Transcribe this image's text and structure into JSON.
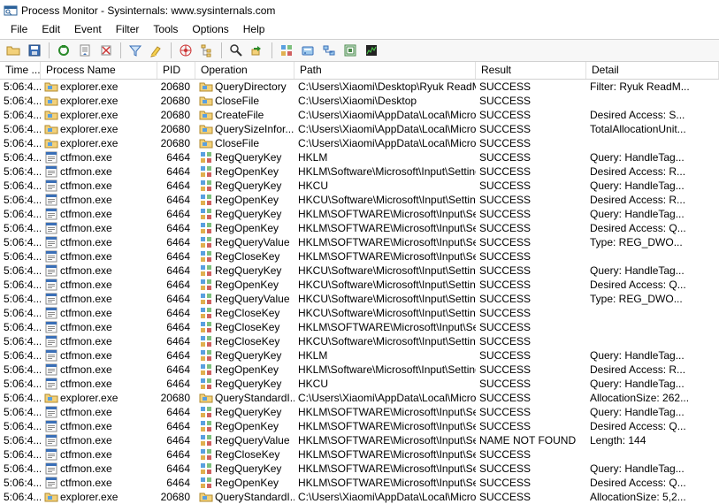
{
  "window": {
    "title": "Process Monitor - Sysinternals: www.sysinternals.com"
  },
  "menu": [
    "File",
    "Edit",
    "Event",
    "Filter",
    "Tools",
    "Options",
    "Help"
  ],
  "toolbar_icons": [
    "open-icon",
    "save-icon",
    "sep",
    "capture-icon",
    "autoscroll-icon",
    "clear-icon",
    "sep",
    "filter-icon",
    "highlight-icon",
    "sep",
    "include-process-icon",
    "tree-icon",
    "sep",
    "find-icon",
    "jump-icon",
    "sep",
    "registry-icon",
    "filesystem-icon",
    "network-icon",
    "process-icon",
    "profiling-icon"
  ],
  "columns": [
    "Time ...",
    "Process Name",
    "PID",
    "Operation",
    "Path",
    "Result",
    "Detail"
  ],
  "rows": [
    {
      "t": "5:06:4...",
      "proc": "explorer.exe",
      "pid": "20680",
      "ptype": "folder",
      "op": "QueryDirectory",
      "otype": "folder",
      "path": "C:\\Users\\Xiaomi\\Desktop\\Ryuk ReadM...",
      "res": "SUCCESS",
      "det": "Filter: Ryuk ReadM..."
    },
    {
      "t": "5:06:4...",
      "proc": "explorer.exe",
      "pid": "20680",
      "ptype": "folder",
      "op": "CloseFile",
      "otype": "folder",
      "path": "C:\\Users\\Xiaomi\\Desktop",
      "res": "SUCCESS",
      "det": ""
    },
    {
      "t": "5:06:4...",
      "proc": "explorer.exe",
      "pid": "20680",
      "ptype": "folder",
      "op": "CreateFile",
      "otype": "folder",
      "path": "C:\\Users\\Xiaomi\\AppData\\Local\\Micro...",
      "res": "SUCCESS",
      "det": "Desired Access: S..."
    },
    {
      "t": "5:06:4...",
      "proc": "explorer.exe",
      "pid": "20680",
      "ptype": "folder",
      "op": "QuerySizeInfor...",
      "otype": "folder",
      "path": "C:\\Users\\Xiaomi\\AppData\\Local\\Micro...",
      "res": "SUCCESS",
      "det": "TotalAllocationUnit..."
    },
    {
      "t": "5:06:4...",
      "proc": "explorer.exe",
      "pid": "20680",
      "ptype": "folder",
      "op": "CloseFile",
      "otype": "folder",
      "path": "C:\\Users\\Xiaomi\\AppData\\Local\\Micro...",
      "res": "SUCCESS",
      "det": ""
    },
    {
      "t": "5:06:4...",
      "proc": "ctfmon.exe",
      "pid": "6464",
      "ptype": "app",
      "op": "RegQueryKey",
      "otype": "reg",
      "path": "HKLM",
      "res": "SUCCESS",
      "det": "Query: HandleTag..."
    },
    {
      "t": "5:06:4...",
      "proc": "ctfmon.exe",
      "pid": "6464",
      "ptype": "app",
      "op": "RegOpenKey",
      "otype": "reg",
      "path": "HKLM\\Software\\Microsoft\\Input\\Settings",
      "res": "SUCCESS",
      "det": "Desired Access: R..."
    },
    {
      "t": "5:06:4...",
      "proc": "ctfmon.exe",
      "pid": "6464",
      "ptype": "app",
      "op": "RegQueryKey",
      "otype": "reg",
      "path": "HKCU",
      "res": "SUCCESS",
      "det": "Query: HandleTag..."
    },
    {
      "t": "5:06:4...",
      "proc": "ctfmon.exe",
      "pid": "6464",
      "ptype": "app",
      "op": "RegOpenKey",
      "otype": "reg",
      "path": "HKCU\\Software\\Microsoft\\Input\\Settin...",
      "res": "SUCCESS",
      "det": "Desired Access: R..."
    },
    {
      "t": "5:06:4...",
      "proc": "ctfmon.exe",
      "pid": "6464",
      "ptype": "app",
      "op": "RegQueryKey",
      "otype": "reg",
      "path": "HKLM\\SOFTWARE\\Microsoft\\Input\\Se...",
      "res": "SUCCESS",
      "det": "Query: HandleTag..."
    },
    {
      "t": "5:06:4...",
      "proc": "ctfmon.exe",
      "pid": "6464",
      "ptype": "app",
      "op": "RegOpenKey",
      "otype": "reg",
      "path": "HKLM\\SOFTWARE\\Microsoft\\Input\\Se...",
      "res": "SUCCESS",
      "det": "Desired Access: Q..."
    },
    {
      "t": "5:06:4...",
      "proc": "ctfmon.exe",
      "pid": "6464",
      "ptype": "app",
      "op": "RegQueryValue",
      "otype": "reg",
      "path": "HKLM\\SOFTWARE\\Microsoft\\Input\\Se...",
      "res": "SUCCESS",
      "det": "Type: REG_DWO..."
    },
    {
      "t": "5:06:4...",
      "proc": "ctfmon.exe",
      "pid": "6464",
      "ptype": "app",
      "op": "RegCloseKey",
      "otype": "reg",
      "path": "HKLM\\SOFTWARE\\Microsoft\\Input\\Se...",
      "res": "SUCCESS",
      "det": ""
    },
    {
      "t": "5:06:4...",
      "proc": "ctfmon.exe",
      "pid": "6464",
      "ptype": "app",
      "op": "RegQueryKey",
      "otype": "reg",
      "path": "HKCU\\Software\\Microsoft\\Input\\Settin...",
      "res": "SUCCESS",
      "det": "Query: HandleTag..."
    },
    {
      "t": "5:06:4...",
      "proc": "ctfmon.exe",
      "pid": "6464",
      "ptype": "app",
      "op": "RegOpenKey",
      "otype": "reg",
      "path": "HKCU\\Software\\Microsoft\\Input\\Settin...",
      "res": "SUCCESS",
      "det": "Desired Access: Q..."
    },
    {
      "t": "5:06:4...",
      "proc": "ctfmon.exe",
      "pid": "6464",
      "ptype": "app",
      "op": "RegQueryValue",
      "otype": "reg",
      "path": "HKCU\\Software\\Microsoft\\Input\\Settin...",
      "res": "SUCCESS",
      "det": "Type: REG_DWO..."
    },
    {
      "t": "5:06:4...",
      "proc": "ctfmon.exe",
      "pid": "6464",
      "ptype": "app",
      "op": "RegCloseKey",
      "otype": "reg",
      "path": "HKCU\\Software\\Microsoft\\Input\\Settin...",
      "res": "SUCCESS",
      "det": ""
    },
    {
      "t": "5:06:4...",
      "proc": "ctfmon.exe",
      "pid": "6464",
      "ptype": "app",
      "op": "RegCloseKey",
      "otype": "reg",
      "path": "HKLM\\SOFTWARE\\Microsoft\\Input\\Se...",
      "res": "SUCCESS",
      "det": ""
    },
    {
      "t": "5:06:4...",
      "proc": "ctfmon.exe",
      "pid": "6464",
      "ptype": "app",
      "op": "RegCloseKey",
      "otype": "reg",
      "path": "HKCU\\Software\\Microsoft\\Input\\Settings",
      "res": "SUCCESS",
      "det": ""
    },
    {
      "t": "5:06:4...",
      "proc": "ctfmon.exe",
      "pid": "6464",
      "ptype": "app",
      "op": "RegQueryKey",
      "otype": "reg",
      "path": "HKLM",
      "res": "SUCCESS",
      "det": "Query: HandleTag..."
    },
    {
      "t": "5:06:4...",
      "proc": "ctfmon.exe",
      "pid": "6464",
      "ptype": "app",
      "op": "RegOpenKey",
      "otype": "reg",
      "path": "HKLM\\Software\\Microsoft\\Input\\Settings",
      "res": "SUCCESS",
      "det": "Desired Access: R..."
    },
    {
      "t": "5:06:4...",
      "proc": "ctfmon.exe",
      "pid": "6464",
      "ptype": "app",
      "op": "RegQueryKey",
      "otype": "reg",
      "path": "HKCU",
      "res": "SUCCESS",
      "det": "Query: HandleTag..."
    },
    {
      "t": "5:06:4...",
      "proc": "explorer.exe",
      "pid": "20680",
      "ptype": "folder",
      "op": "QueryStandardI...",
      "otype": "folder",
      "path": "C:\\Users\\Xiaomi\\AppData\\Local\\Micro...",
      "res": "SUCCESS",
      "det": "AllocationSize: 262..."
    },
    {
      "t": "5:06:4...",
      "proc": "ctfmon.exe",
      "pid": "6464",
      "ptype": "app",
      "op": "RegQueryKey",
      "otype": "reg",
      "path": "HKLM\\SOFTWARE\\Microsoft\\Input\\Se...",
      "res": "SUCCESS",
      "det": "Query: HandleTag..."
    },
    {
      "t": "5:06:4...",
      "proc": "ctfmon.exe",
      "pid": "6464",
      "ptype": "app",
      "op": "RegOpenKey",
      "otype": "reg",
      "path": "HKLM\\SOFTWARE\\Microsoft\\Input\\Se...",
      "res": "SUCCESS",
      "det": "Desired Access: Q..."
    },
    {
      "t": "5:06:4...",
      "proc": "ctfmon.exe",
      "pid": "6464",
      "ptype": "app",
      "op": "RegQueryValue",
      "otype": "reg",
      "path": "HKLM\\SOFTWARE\\Microsoft\\Input\\Se...",
      "res": "NAME NOT FOUND",
      "det": "Length: 144"
    },
    {
      "t": "5:06:4...",
      "proc": "ctfmon.exe",
      "pid": "6464",
      "ptype": "app",
      "op": "RegCloseKey",
      "otype": "reg",
      "path": "HKLM\\SOFTWARE\\Microsoft\\Input\\Se...",
      "res": "SUCCESS",
      "det": ""
    },
    {
      "t": "5:06:4...",
      "proc": "ctfmon.exe",
      "pid": "6464",
      "ptype": "app",
      "op": "RegQueryKey",
      "otype": "reg",
      "path": "HKLM\\SOFTWARE\\Microsoft\\Input\\Se...",
      "res": "SUCCESS",
      "det": "Query: HandleTag..."
    },
    {
      "t": "5:06:4...",
      "proc": "ctfmon.exe",
      "pid": "6464",
      "ptype": "app",
      "op": "RegOpenKey",
      "otype": "reg",
      "path": "HKLM\\SOFTWARE\\Microsoft\\Input\\Se...",
      "res": "SUCCESS",
      "det": "Desired Access: Q..."
    },
    {
      "t": "5:06:4...",
      "proc": "explorer.exe",
      "pid": "20680",
      "ptype": "folder",
      "op": "QueryStandardI...",
      "otype": "folder",
      "path": "C:\\Users\\Xiaomi\\AppData\\Local\\Micro...",
      "res": "SUCCESS",
      "det": "AllocationSize: 5,2..."
    }
  ]
}
